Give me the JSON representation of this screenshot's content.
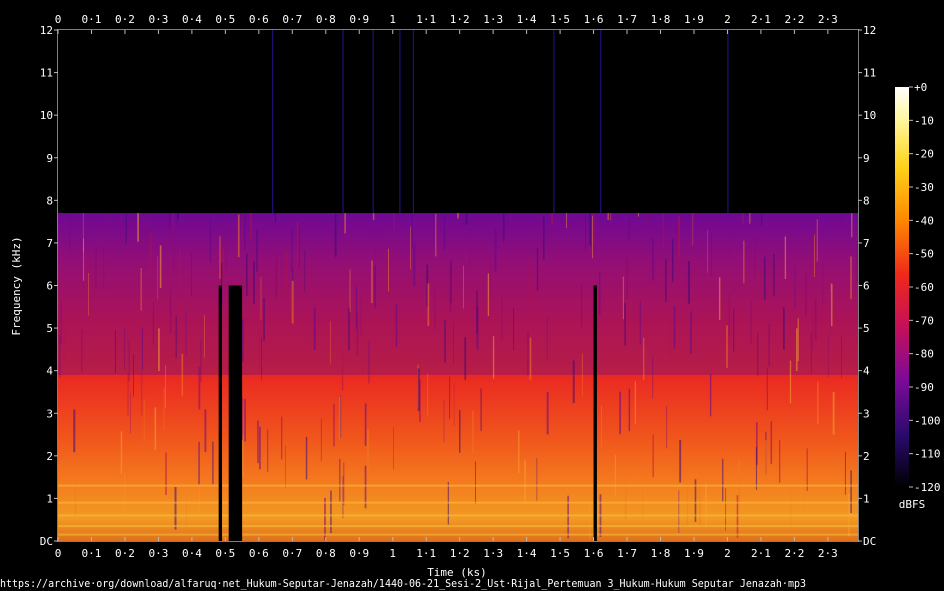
{
  "chart_data": {
    "type": "heatmap",
    "title": "",
    "xlabel": "Time (ks)",
    "ylabel": "Frequency (kHz)",
    "xlim": [
      0,
      2.39
    ],
    "ylim": [
      0,
      12
    ],
    "x_ticks": [
      "0",
      "0·1",
      "0·2",
      "0·3",
      "0·4",
      "0·5",
      "0·6",
      "0·7",
      "0·8",
      "0·9",
      "1",
      "1·1",
      "1·2",
      "1·3",
      "1·4",
      "1·5",
      "1·6",
      "1·7",
      "1·8",
      "1·9",
      "2",
      "2·1",
      "2·2",
      "2·3"
    ],
    "y_ticks": [
      "DC",
      "1",
      "2",
      "3",
      "4",
      "5",
      "6",
      "7",
      "8",
      "9",
      "10",
      "11",
      "12"
    ],
    "colorbar": {
      "label": "dBFS",
      "range": [
        -120,
        0
      ],
      "ticks": [
        "+0",
        "-10",
        "-20",
        "-30",
        "-40",
        "-50",
        "-60",
        "-70",
        "-80",
        "-90",
        "-100",
        "-110",
        "-120"
      ]
    },
    "energy_cutoff_khz": 7.7,
    "dropouts_ks": [
      [
        0.48,
        0.49
      ],
      [
        0.51,
        0.55
      ],
      [
        1.6,
        1.61
      ]
    ],
    "spikes_ks": [
      0.64,
      0.85,
      0.94,
      1.02,
      1.06,
      1.48,
      1.62,
      2.0
    ],
    "grid": false,
    "legend": "colorbar-right"
  },
  "footer": {
    "source_url": "https://archive·org/download/alfaruq·net_Hukum-Seputar-Jenazah/1440-06-21_Sesi-2_Ust·Rijal_Pertemuan 3_Hukum-Hukum Seputar Jenazah·mp3"
  }
}
